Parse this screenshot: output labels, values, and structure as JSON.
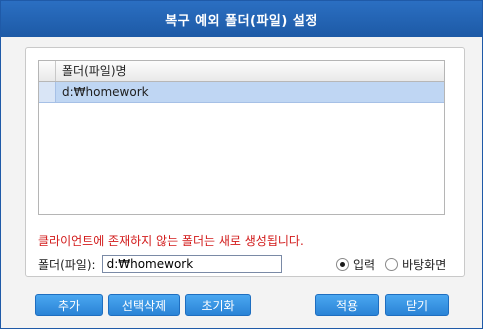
{
  "window": {
    "title": "복구 예외 폴더(파일) 설정"
  },
  "list": {
    "column_header": "폴더(파일)명",
    "rows": [
      "d:₩homework"
    ]
  },
  "notice": "클라이언트에 존재하지 않는 폴더는 새로 생성됩니다.",
  "field": {
    "label": "폴더(파일):",
    "value": "d:₩homework"
  },
  "radio": {
    "options": [
      "입력",
      "바탕화면"
    ],
    "selected": "입력"
  },
  "buttons": {
    "add": "추가",
    "delete_selected": "선택삭제",
    "reset": "초기화",
    "apply": "적용",
    "close": "닫기"
  },
  "colors": {
    "title_bar": "#1f5aa8",
    "selected_row": "#bfd6f3",
    "notice_text": "#d21a1a",
    "button": "#3a96e6"
  }
}
